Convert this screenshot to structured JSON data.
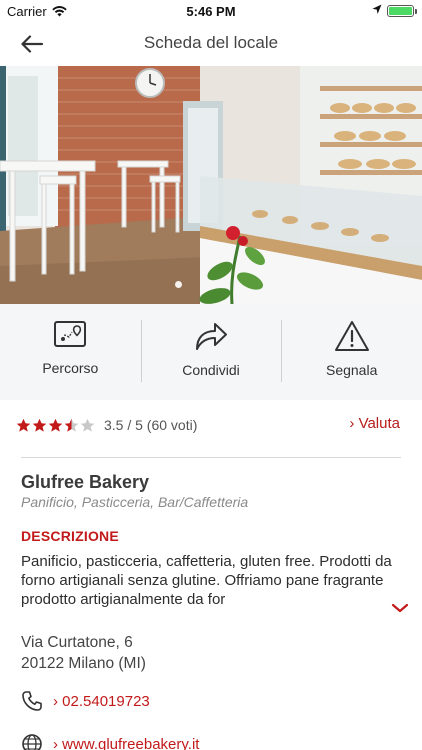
{
  "status_bar": {
    "carrier": "Carrier",
    "time": "5:46 PM",
    "battery_level": 1.0
  },
  "nav": {
    "title": "Scheda del locale",
    "back_icon": "arrow-left-icon"
  },
  "gallery": {
    "page_count": 1,
    "current_page": 1
  },
  "actions": [
    {
      "label": "Percorso",
      "icon": "route-map-icon"
    },
    {
      "label": "Condividi",
      "icon": "share-arrow-icon"
    },
    {
      "label": "Segnala",
      "icon": "warning-icon"
    }
  ],
  "rating": {
    "value": 3.5,
    "max": 5,
    "text": "3.5 / 5 (60 voti)",
    "rate_label": "› Valuta"
  },
  "place": {
    "name": "Glufree Bakery",
    "category": "Panificio, Pasticceria, Bar/Caffetteria"
  },
  "description": {
    "title": "DESCRIZIONE",
    "text": "Panificio, pasticceria, caffetteria, gluten free. Prodotti da forno artigianali senza glutine. Offriamo pane fragrante prodotto artigianalmente da for"
  },
  "address": {
    "line1": "Via Curtatone, 6",
    "line2": "20122 Milano (MI)"
  },
  "contacts": {
    "phone": "› 02.54019723",
    "website": "› www.glufreebakery.it"
  },
  "colors": {
    "accent": "#c21a1a",
    "star": "#c21a1a",
    "star_empty": "#c8c8c8",
    "panel_bg": "#f5f6f7"
  }
}
